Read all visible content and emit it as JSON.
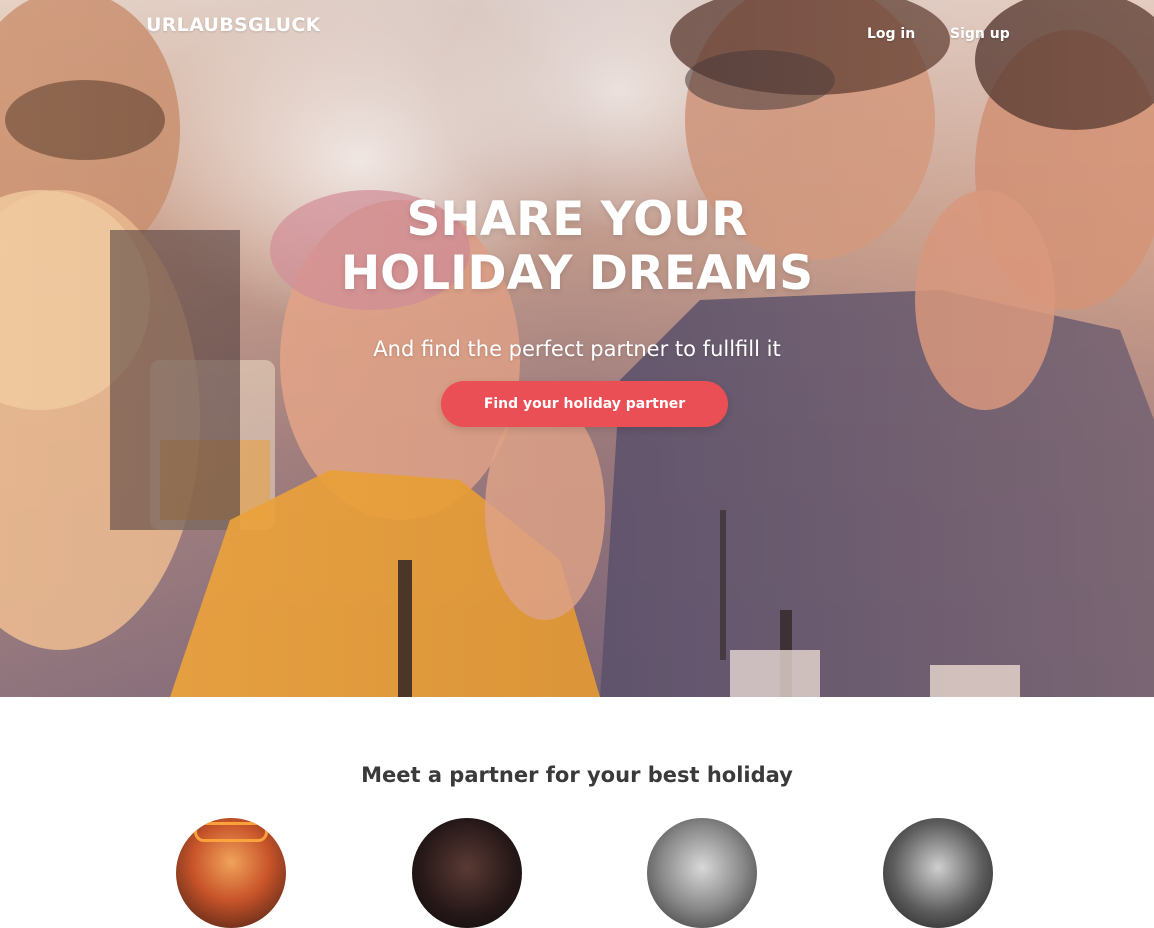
{
  "nav": {
    "brand": "URLAUBSGLUCK",
    "login_label": "Log in",
    "signup_label": "Sign up"
  },
  "hero": {
    "headline_line1": "SHARE YOUR",
    "headline_line2": "HOLIDAY DREAMS",
    "subheadline": "And find the perfect partner to fullfill it",
    "cta_label": "Find your holiday partner"
  },
  "partners_section": {
    "title": "Meet a partner for your best holiday",
    "avatar_count": 4
  },
  "colors": {
    "cta_background": "#ea4f55",
    "section_title": "#3a3a3a",
    "hero_text": "#ffffff"
  }
}
